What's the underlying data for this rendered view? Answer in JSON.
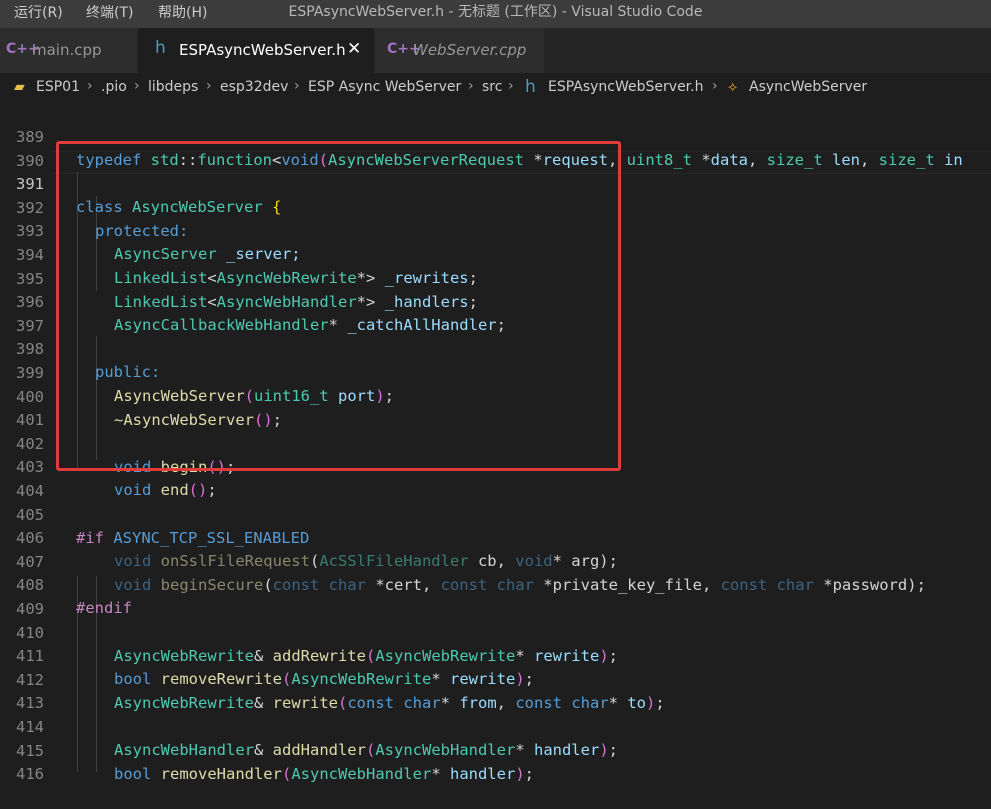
{
  "menu": {
    "run": "运行(R)",
    "terminal": "终端(T)",
    "help": "帮助(H)"
  },
  "window_title": "ESPAsyncWebServer.h - 无标题 (工作区) - Visual Studio Code",
  "tabs": [
    {
      "icon": "C++",
      "label": "main.cpp"
    },
    {
      "icon": "h",
      "label": "ESPAsyncWebServer.h",
      "close": "✕"
    },
    {
      "icon": "C++",
      "label": "WebServer.cpp"
    }
  ],
  "breadcrumb": {
    "items": [
      "ESP01",
      ".pio",
      "libdeps",
      "esp32dev",
      "ESP Async WebServer",
      "src",
      "ESPAsyncWebServer.h",
      "AsyncWebServer"
    ],
    "sep": "›",
    "file_icon": "h",
    "class_icon": "⟡"
  },
  "colors": {
    "highlight_box": "#e03c3c",
    "keyword": "#569cd6",
    "type": "#4ec9b0",
    "function": "#dcdcaa",
    "variable": "#9cdcfe",
    "preprocessor": "#c586c0"
  },
  "code": {
    "line_numbers": [
      "389",
      "390",
      "391",
      "392",
      "393",
      "394",
      "395",
      "396",
      "397",
      "398",
      "399",
      "400",
      "401",
      "402",
      "403",
      "404",
      "405",
      "406",
      "407",
      "408",
      "409",
      "410",
      "411",
      "412",
      "413",
      "414",
      "415",
      "416"
    ],
    "l389": {
      "a": "typedef",
      "b": "std",
      "c": "::",
      "d": "function",
      "e": "<",
      "f": "void",
      "g": "(",
      "h": "AsyncWebServerRequest",
      "i": " *",
      "j": "request",
      "k": ", ",
      "l": "uint8_t",
      "m": " *",
      "n": "data",
      "o": ", ",
      "p": "size_t",
      "q": " ",
      "r": "len",
      "s": ", ",
      "t": "size_t",
      "u": " in"
    },
    "l391": {
      "a": "class",
      "b": "AsyncWebServer",
      "c": "{"
    },
    "l392": "protected:",
    "l393": {
      "a": "AsyncServer",
      "b": " _server;"
    },
    "l394": {
      "a": "LinkedList",
      "b": "<",
      "c": "AsyncWebRewrite",
      "d": "*> ",
      "e": "_rewrites",
      "f": ";"
    },
    "l395": {
      "a": "LinkedList",
      "b": "<",
      "c": "AsyncWebHandler",
      "d": "*> ",
      "e": "_handlers",
      "f": ";"
    },
    "l396": {
      "a": "AsyncCallbackWebHandler",
      "b": "* ",
      "c": "_catchAllHandler",
      "d": ";"
    },
    "l398": "public:",
    "l399": {
      "a": "AsyncWebServer",
      "b": "(",
      "c": "uint16_t",
      "d": " port",
      "e": ")",
      "f": ";"
    },
    "l400": {
      "a": "~AsyncWebServer",
      "b": "()",
      "c": ";"
    },
    "l402": {
      "a": "void",
      "b": " begin",
      "c": "()",
      "d": ";"
    },
    "l403": {
      "a": "void",
      "b": " end",
      "c": "()",
      "d": ";"
    },
    "l405": {
      "a": "#if",
      "b": " ASYNC_TCP_SSL_ENABLED"
    },
    "l406": {
      "a": "void",
      "b": " onSslFileRequest",
      "c": "(",
      "d": "AcSSlFileHandler",
      "e": " cb, ",
      "f": "void",
      "g": "* arg",
      "h": ")",
      "i": ";"
    },
    "l407": {
      "a": "void",
      "b": " beginSecure",
      "c": "(",
      "d": "const char",
      "e": " *cert, ",
      "f": "const char",
      "g": " *private_key_file, ",
      "h": "const char",
      "i": " *password",
      "j": ")",
      "k": ";"
    },
    "l408": "#endif",
    "l410": {
      "a": "AsyncWebRewrite",
      "b": "& ",
      "c": "addRewrite",
      "d": "(",
      "e": "AsyncWebRewrite",
      "f": "* ",
      "g": "rewrite",
      "h": ")",
      "i": ";"
    },
    "l411": {
      "a": "bool",
      "b": " removeRewrite",
      "c": "(",
      "d": "AsyncWebRewrite",
      "e": "* ",
      "f": "rewrite",
      "g": ")",
      "h": ";"
    },
    "l412": {
      "a": "AsyncWebRewrite",
      "b": "& ",
      "c": "rewrite",
      "d": "(",
      "e": "const char",
      "f": "* ",
      "g": "from",
      "h": ", ",
      "i": "const char",
      "j": "* ",
      "k": "to",
      "l": ")",
      "m": ";"
    },
    "l414": {
      "a": "AsyncWebHandler",
      "b": "& ",
      "c": "addHandler",
      "d": "(",
      "e": "AsyncWebHandler",
      "f": "* ",
      "g": "handler",
      "h": ")",
      "i": ";"
    },
    "l415": {
      "a": "bool",
      "b": " removeHandler",
      "c": "(",
      "d": "AsyncWebHandler",
      "e": "* ",
      "f": "handler",
      "g": ")",
      "h": ";"
    }
  }
}
